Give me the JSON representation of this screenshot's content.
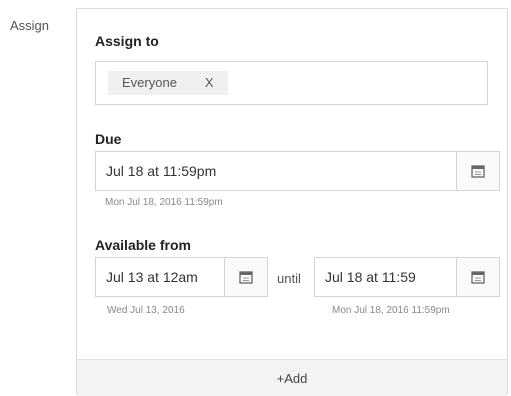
{
  "assign_label": "Assign",
  "assign_to": {
    "title": "Assign to",
    "tags": [
      {
        "label": "Everyone",
        "remove": "X"
      }
    ]
  },
  "due": {
    "title": "Due",
    "value": "Jul 18 at 11:59pm",
    "hint": "Mon Jul 18, 2016 11:59pm"
  },
  "available": {
    "title": "Available from",
    "from_value": "Jul 13 at 12am",
    "from_hint": "Wed Jul 13, 2016",
    "until_label": "until",
    "until_value": "Jul 18 at 11:59",
    "until_hint": "Mon Jul 18, 2016 11:59pm"
  },
  "add_label": "+Add",
  "icons": {
    "calendar": "calendar-icon"
  }
}
